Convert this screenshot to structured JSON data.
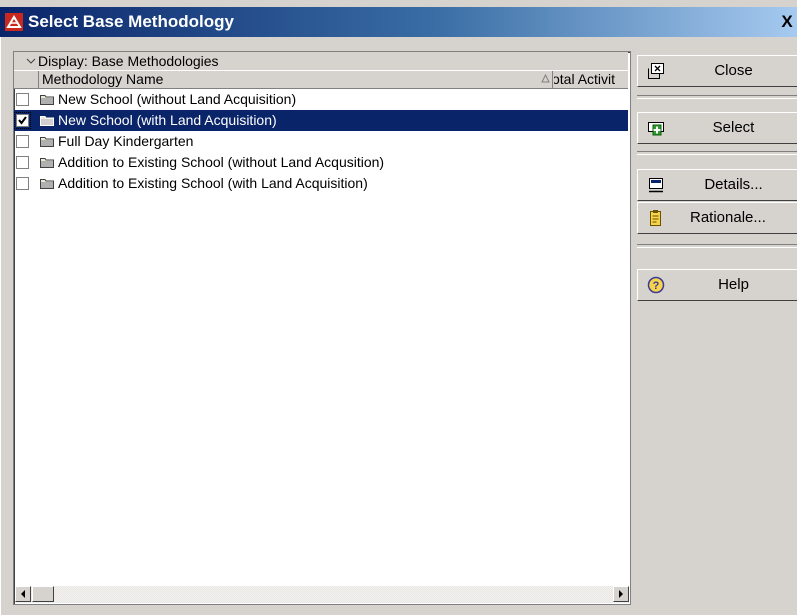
{
  "window": {
    "title": "Select Base Methodology",
    "close_glyph": "X"
  },
  "list": {
    "group_header": "Display: Base Methodologies",
    "columns": {
      "name": "Methodology Name",
      "total": "otal Activit"
    },
    "rows": [
      {
        "label": "New School (without Land Acquisition)",
        "checked": false,
        "selected": false
      },
      {
        "label": "New School (with Land Acquisition)",
        "checked": true,
        "selected": true
      },
      {
        "label": "Full Day Kindergarten",
        "checked": false,
        "selected": false
      },
      {
        "label": "Addition to Existing School (without Land Acqusition)",
        "checked": false,
        "selected": false
      },
      {
        "label": "Addition to Existing School (with Land Acquisition)",
        "checked": false,
        "selected": false
      }
    ]
  },
  "buttons": {
    "close": "Close",
    "select": "Select",
    "details": "Details...",
    "rationale": "Rationale...",
    "help": "Help"
  },
  "icons": {
    "app": "app-logo-icon",
    "close": "close-window-icon",
    "select": "select-plus-icon",
    "details": "details-monitor-icon",
    "rationale": "rationale-clipboard-icon",
    "help": "help-question-icon",
    "folder": "folder-icon"
  },
  "colors": {
    "title_start": "#0a246a",
    "title_end": "#a6caf0",
    "selection": "#0a246a",
    "face": "#d6d3ce"
  }
}
